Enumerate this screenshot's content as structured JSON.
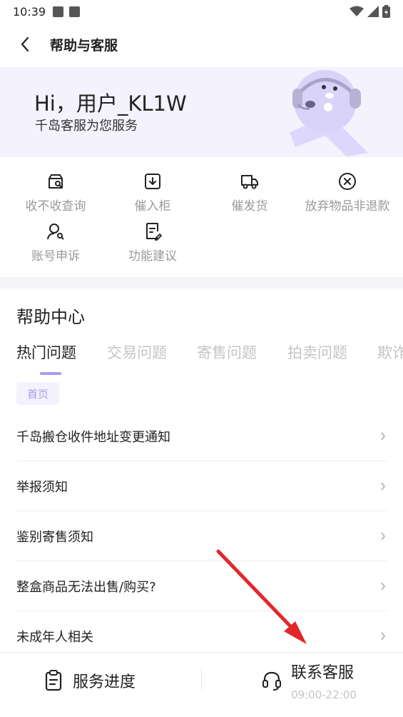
{
  "status_bar": {
    "time": "10:39"
  },
  "nav": {
    "title": "帮助与客服"
  },
  "hero": {
    "greeting": "Hi，用户_KL1W",
    "subtitle": "千岛客服为您服务"
  },
  "quick_actions": [
    {
      "label": "收不收查询",
      "icon": "box-search-icon"
    },
    {
      "label": "催入柜",
      "icon": "box-download-icon"
    },
    {
      "label": "催发货",
      "icon": "truck-icon"
    },
    {
      "label": "放弃物品非退款",
      "icon": "circle-x-icon"
    },
    {
      "label": "账号申诉",
      "icon": "user-search-icon"
    },
    {
      "label": "功能建议",
      "icon": "doc-edit-icon"
    }
  ],
  "help_center": {
    "title": "帮助中心",
    "tabs": [
      "热门问题",
      "交易问题",
      "寄售问题",
      "拍卖问题",
      "欺诈"
    ],
    "active_tab": "热门问题",
    "chip": "首页",
    "items": [
      "千岛搬仓收件地址变更通知",
      "举报须知",
      "鉴别寄售须知",
      "整盒商品无法出售/购买?",
      "未成年人相关"
    ]
  },
  "bottom_bar": {
    "progress_label": "服务进度",
    "contact_label": "联系客服",
    "contact_hours": "09:00-22:00"
  },
  "colors": {
    "accent": "#a79df0",
    "hero_bg": "#f4f2fc",
    "annotation_arrow": "#e3262b"
  }
}
